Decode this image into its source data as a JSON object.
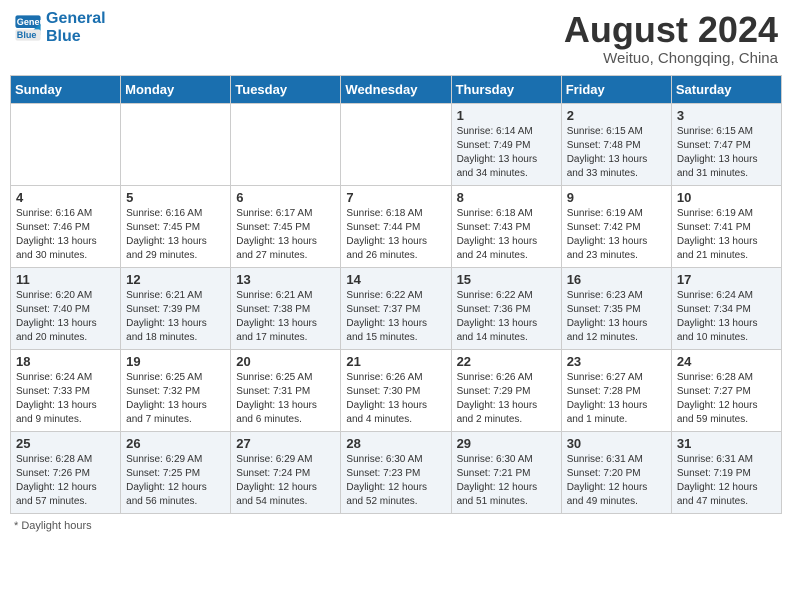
{
  "header": {
    "logo_line1": "General",
    "logo_line2": "Blue",
    "month_year": "August 2024",
    "location": "Weituo, Chongqing, China"
  },
  "days_of_week": [
    "Sunday",
    "Monday",
    "Tuesday",
    "Wednesday",
    "Thursday",
    "Friday",
    "Saturday"
  ],
  "footer": {
    "daylight_label": "Daylight hours"
  },
  "weeks": [
    [
      {
        "day": "",
        "info": ""
      },
      {
        "day": "",
        "info": ""
      },
      {
        "day": "",
        "info": ""
      },
      {
        "day": "",
        "info": ""
      },
      {
        "day": "1",
        "info": "Sunrise: 6:14 AM\nSunset: 7:49 PM\nDaylight: 13 hours\nand 34 minutes."
      },
      {
        "day": "2",
        "info": "Sunrise: 6:15 AM\nSunset: 7:48 PM\nDaylight: 13 hours\nand 33 minutes."
      },
      {
        "day": "3",
        "info": "Sunrise: 6:15 AM\nSunset: 7:47 PM\nDaylight: 13 hours\nand 31 minutes."
      }
    ],
    [
      {
        "day": "4",
        "info": "Sunrise: 6:16 AM\nSunset: 7:46 PM\nDaylight: 13 hours\nand 30 minutes."
      },
      {
        "day": "5",
        "info": "Sunrise: 6:16 AM\nSunset: 7:45 PM\nDaylight: 13 hours\nand 29 minutes."
      },
      {
        "day": "6",
        "info": "Sunrise: 6:17 AM\nSunset: 7:45 PM\nDaylight: 13 hours\nand 27 minutes."
      },
      {
        "day": "7",
        "info": "Sunrise: 6:18 AM\nSunset: 7:44 PM\nDaylight: 13 hours\nand 26 minutes."
      },
      {
        "day": "8",
        "info": "Sunrise: 6:18 AM\nSunset: 7:43 PM\nDaylight: 13 hours\nand 24 minutes."
      },
      {
        "day": "9",
        "info": "Sunrise: 6:19 AM\nSunset: 7:42 PM\nDaylight: 13 hours\nand 23 minutes."
      },
      {
        "day": "10",
        "info": "Sunrise: 6:19 AM\nSunset: 7:41 PM\nDaylight: 13 hours\nand 21 minutes."
      }
    ],
    [
      {
        "day": "11",
        "info": "Sunrise: 6:20 AM\nSunset: 7:40 PM\nDaylight: 13 hours\nand 20 minutes."
      },
      {
        "day": "12",
        "info": "Sunrise: 6:21 AM\nSunset: 7:39 PM\nDaylight: 13 hours\nand 18 minutes."
      },
      {
        "day": "13",
        "info": "Sunrise: 6:21 AM\nSunset: 7:38 PM\nDaylight: 13 hours\nand 17 minutes."
      },
      {
        "day": "14",
        "info": "Sunrise: 6:22 AM\nSunset: 7:37 PM\nDaylight: 13 hours\nand 15 minutes."
      },
      {
        "day": "15",
        "info": "Sunrise: 6:22 AM\nSunset: 7:36 PM\nDaylight: 13 hours\nand 14 minutes."
      },
      {
        "day": "16",
        "info": "Sunrise: 6:23 AM\nSunset: 7:35 PM\nDaylight: 13 hours\nand 12 minutes."
      },
      {
        "day": "17",
        "info": "Sunrise: 6:24 AM\nSunset: 7:34 PM\nDaylight: 13 hours\nand 10 minutes."
      }
    ],
    [
      {
        "day": "18",
        "info": "Sunrise: 6:24 AM\nSunset: 7:33 PM\nDaylight: 13 hours\nand 9 minutes."
      },
      {
        "day": "19",
        "info": "Sunrise: 6:25 AM\nSunset: 7:32 PM\nDaylight: 13 hours\nand 7 minutes."
      },
      {
        "day": "20",
        "info": "Sunrise: 6:25 AM\nSunset: 7:31 PM\nDaylight: 13 hours\nand 6 minutes."
      },
      {
        "day": "21",
        "info": "Sunrise: 6:26 AM\nSunset: 7:30 PM\nDaylight: 13 hours\nand 4 minutes."
      },
      {
        "day": "22",
        "info": "Sunrise: 6:26 AM\nSunset: 7:29 PM\nDaylight: 13 hours\nand 2 minutes."
      },
      {
        "day": "23",
        "info": "Sunrise: 6:27 AM\nSunset: 7:28 PM\nDaylight: 13 hours\nand 1 minute."
      },
      {
        "day": "24",
        "info": "Sunrise: 6:28 AM\nSunset: 7:27 PM\nDaylight: 12 hours\nand 59 minutes."
      }
    ],
    [
      {
        "day": "25",
        "info": "Sunrise: 6:28 AM\nSunset: 7:26 PM\nDaylight: 12 hours\nand 57 minutes."
      },
      {
        "day": "26",
        "info": "Sunrise: 6:29 AM\nSunset: 7:25 PM\nDaylight: 12 hours\nand 56 minutes."
      },
      {
        "day": "27",
        "info": "Sunrise: 6:29 AM\nSunset: 7:24 PM\nDaylight: 12 hours\nand 54 minutes."
      },
      {
        "day": "28",
        "info": "Sunrise: 6:30 AM\nSunset: 7:23 PM\nDaylight: 12 hours\nand 52 minutes."
      },
      {
        "day": "29",
        "info": "Sunrise: 6:30 AM\nSunset: 7:21 PM\nDaylight: 12 hours\nand 51 minutes."
      },
      {
        "day": "30",
        "info": "Sunrise: 6:31 AM\nSunset: 7:20 PM\nDaylight: 12 hours\nand 49 minutes."
      },
      {
        "day": "31",
        "info": "Sunrise: 6:31 AM\nSunset: 7:19 PM\nDaylight: 12 hours\nand 47 minutes."
      }
    ]
  ]
}
